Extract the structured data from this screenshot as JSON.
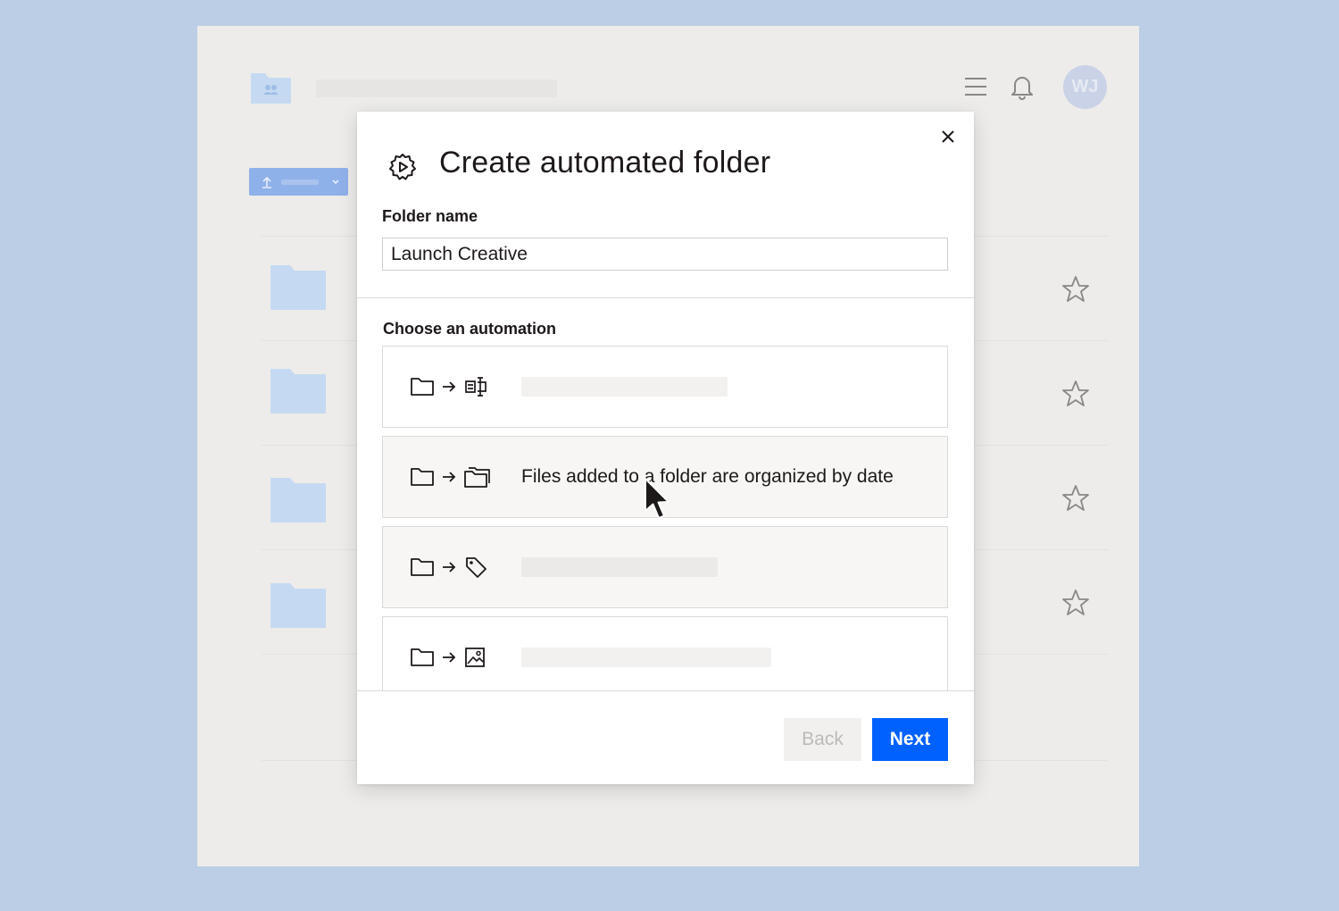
{
  "background_app": {
    "avatar_initials": "WJ",
    "folder_rows": 4,
    "icons": [
      "team-folder-icon",
      "menu-icon",
      "bell-icon",
      "upload-icon",
      "chevron-down-icon",
      "folder-icon",
      "star-icon"
    ]
  },
  "modal": {
    "title": "Create automated folder",
    "title_icon": "gear-icon",
    "close_icon": "close-icon",
    "folder_name_label": "Folder name",
    "folder_name_value": "Launch Creative",
    "automation_label": "Choose an automation",
    "automations": [
      {
        "icons": [
          "folder-icon",
          "arrow-right-icon",
          "rename-icon"
        ],
        "label": ""
      },
      {
        "icons": [
          "folder-icon",
          "arrow-right-icon",
          "folders-icon"
        ],
        "label": "Files added to a folder are organized by date"
      },
      {
        "icons": [
          "folder-icon",
          "arrow-right-icon",
          "tag-icon"
        ],
        "label": ""
      },
      {
        "icons": [
          "folder-icon",
          "arrow-right-icon",
          "image-icon"
        ],
        "label": ""
      }
    ],
    "back_label": "Back",
    "next_label": "Next"
  },
  "colors": {
    "page_background": "#bccee6",
    "app_background": "#edecea",
    "primary_button": "#0061fe",
    "folder_blue": "#c5daf2"
  }
}
